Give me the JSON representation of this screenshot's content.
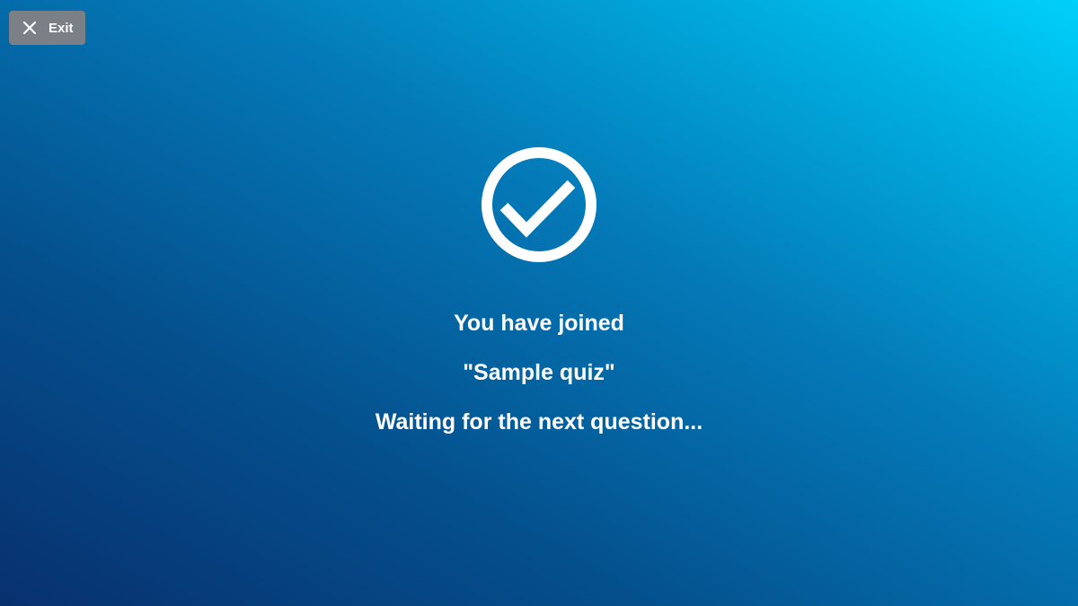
{
  "exit_button": {
    "label": "Exit",
    "icon": "close-icon"
  },
  "status": {
    "icon": "check-circle-icon",
    "joined_text": "You have joined",
    "quiz_name": "\"Sample quiz\"",
    "waiting_text": "Waiting for the next question..."
  },
  "colors": {
    "background_start": "#08306f",
    "background_end": "#00d0fa",
    "button_background": "#7a8086",
    "text": "#ffffff"
  }
}
